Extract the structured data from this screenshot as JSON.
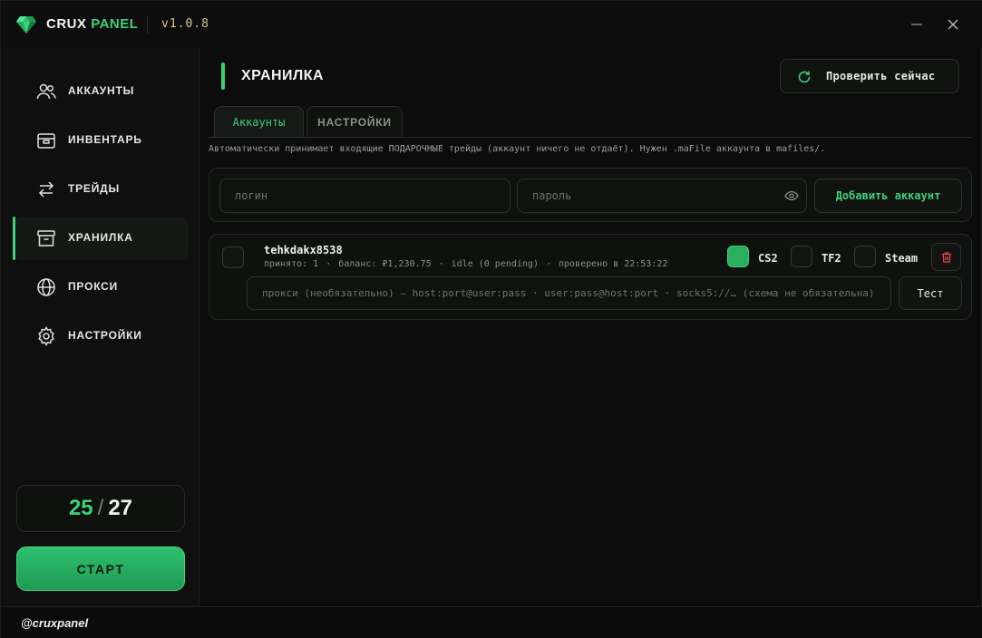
{
  "app": {
    "brand_main": "CRUX",
    "brand_accent": "PANEL",
    "version": "v1.0.8",
    "accent_color": "#3ecf7a",
    "logo_icon": "emerald-gem-icon"
  },
  "window_controls": {
    "minimize_icon": "minimize-icon",
    "close_icon": "close-icon"
  },
  "sidebar": {
    "items": [
      {
        "label": "АККАУНТЫ",
        "icon": "users-icon",
        "active": false
      },
      {
        "label": "ИНВЕНТАРЬ",
        "icon": "inventory-icon",
        "active": false
      },
      {
        "label": "ТРЕЙДЫ",
        "icon": "swap-arrows-icon",
        "active": false
      },
      {
        "label": "ХРАНИЛКА",
        "icon": "archive-box-icon",
        "active": true
      },
      {
        "label": "ПРОКСИ",
        "icon": "globe-icon",
        "active": false
      },
      {
        "label": "НАСТРОЙКИ",
        "icon": "gear-icon",
        "active": false
      }
    ],
    "counter": {
      "current": "25",
      "separator": "/",
      "total": "27"
    },
    "start_label": "СТАРТ"
  },
  "footer": {
    "handle": "@cruxpanel"
  },
  "main": {
    "title": "ХРАНИЛКА",
    "check_now_label": "Проверить сейчас",
    "tabs": [
      {
        "label": "Аккаунты",
        "active": true
      },
      {
        "label": "НАСТРОЙКИ",
        "active": false
      }
    ],
    "hint": "Автоматически принимает входящие ПОДАРОЧНЫЕ трейды (аккаунт ничего не отдаёт). Нужен .maFile аккаунта в mafiles/.",
    "add_form": {
      "login_placeholder": "логин",
      "password_placeholder": "пароль",
      "add_label": "Добавить аккаунт"
    },
    "accounts": [
      {
        "name": "tehkdakx8538",
        "accepted": "принято: 1",
        "balance": "баланс: ₽1,230.75",
        "status": "idle (0 pending)",
        "checked": "проверено в 22:53:22",
        "games": [
          {
            "label": "CS2",
            "enabled": true
          },
          {
            "label": "TF2",
            "enabled": false
          },
          {
            "label": "Steam",
            "enabled": false
          }
        ],
        "proxy_placeholder": "прокси (необязательно) — host:port@user:pass · user:pass@host:port · socks5://… (схема не обязательна)",
        "test_label": "Тест"
      }
    ]
  }
}
